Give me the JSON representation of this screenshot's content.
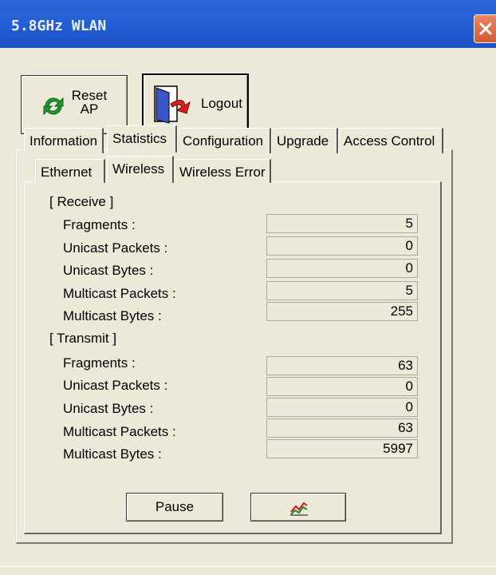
{
  "window": {
    "title": "5.8GHz WLAN"
  },
  "toolbar": {
    "reset_label_line1": "Reset",
    "reset_label_line2": "AP",
    "logout_label": "Logout"
  },
  "main_tabs": [
    {
      "label": "Information",
      "active": false
    },
    {
      "label": "Statistics",
      "active": true
    },
    {
      "label": "Configuration",
      "active": false
    },
    {
      "label": "Upgrade",
      "active": false
    },
    {
      "label": "Access Control",
      "active": false
    }
  ],
  "sub_tabs": [
    {
      "label": "Ethernet",
      "active": false
    },
    {
      "label": "Wireless",
      "active": true
    },
    {
      "label": "Wireless Error",
      "active": false
    }
  ],
  "receive": {
    "heading": "[ Receive ]",
    "rows": [
      {
        "label": "Fragments :",
        "value": "5"
      },
      {
        "label": "Unicast Packets :",
        "value": "0"
      },
      {
        "label": "Unicast Bytes :",
        "value": "0"
      },
      {
        "label": "Multicast Packets :",
        "value": "5"
      },
      {
        "label": "Multicast Bytes :",
        "value": "255"
      }
    ]
  },
  "transmit": {
    "heading": "[ Transmit ]",
    "rows": [
      {
        "label": "Fragments :",
        "value": "63"
      },
      {
        "label": "Unicast Packets :",
        "value": "0"
      },
      {
        "label": "Unicast Bytes :",
        "value": "0"
      },
      {
        "label": "Multicast Packets :",
        "value": "63"
      },
      {
        "label": "Multicast Bytes :",
        "value": "5997"
      }
    ]
  },
  "actions": {
    "pause_label": "Pause",
    "chart_icon": "chart-icon"
  },
  "colors": {
    "titlebar": "#2561d6",
    "face": "#ece9d8",
    "close": "#d45a32"
  }
}
